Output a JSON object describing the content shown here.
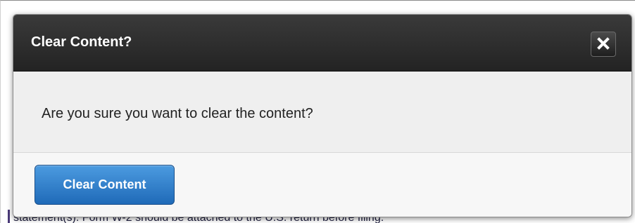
{
  "dialog": {
    "title": "Clear Content?",
    "message": "Are you sure you want to clear the content?",
    "confirm_label": "Clear Content",
    "close_icon": "close-icon"
  },
  "background": {
    "partial_text": "statement(s). Form W-2 should be attached to the U.S. return before filing."
  },
  "colors": {
    "header": "#2b2b2b",
    "primary_button": "#2a78c8",
    "body": "#efefef"
  }
}
